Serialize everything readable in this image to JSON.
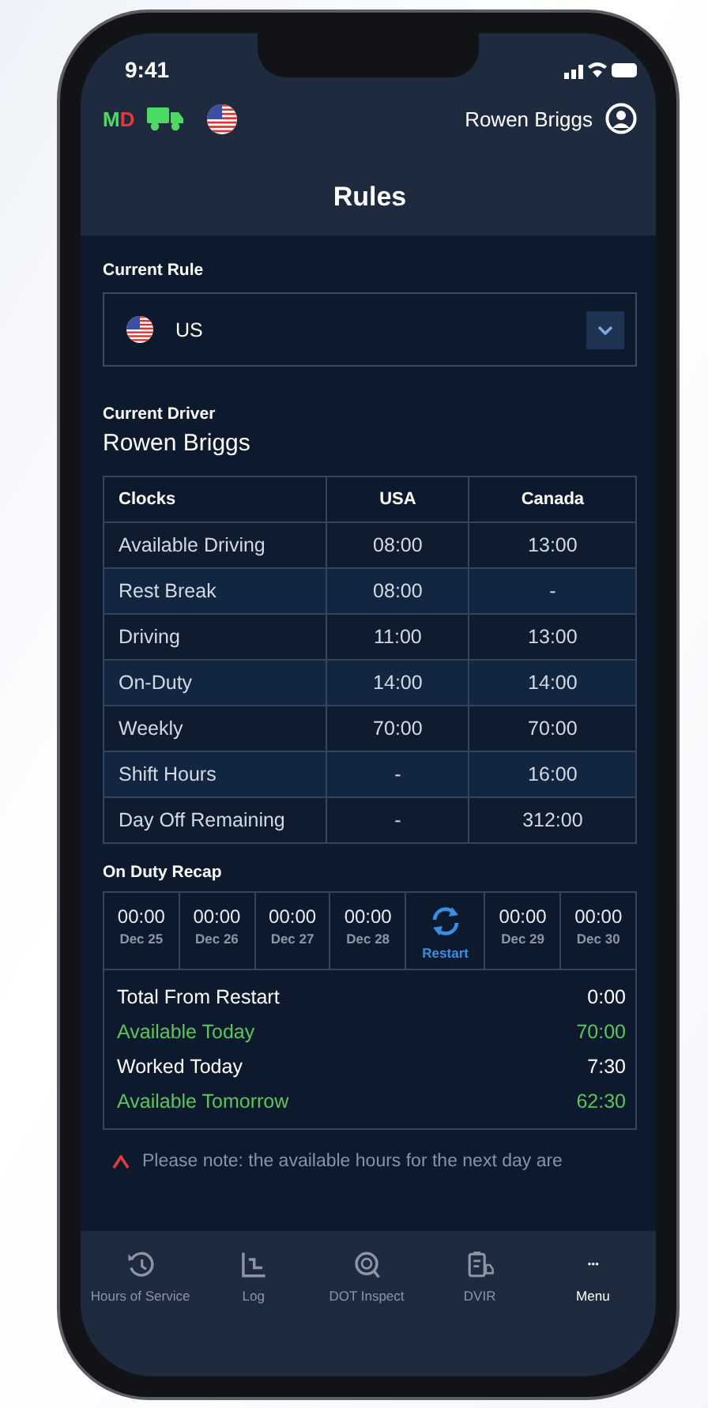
{
  "status_bar": {
    "time": "9:41"
  },
  "top_bar": {
    "badge_letters": [
      {
        "text": "M",
        "color": "#4cd964"
      },
      {
        "text": "D",
        "color": "#e5383b"
      }
    ],
    "user_name": "Rowen Briggs"
  },
  "title": "Rules",
  "current_rule": {
    "label": "Current Rule",
    "value": "US"
  },
  "current_driver": {
    "label": "Current Driver",
    "name": "Rowen Briggs"
  },
  "clocks_table": {
    "columns": [
      "Clocks",
      "USA",
      "Canada"
    ],
    "rows": [
      [
        "Available Driving",
        "08:00",
        "13:00"
      ],
      [
        "Rest Break",
        "08:00",
        "-"
      ],
      [
        "Driving",
        "11:00",
        "13:00"
      ],
      [
        "On-Duty",
        "14:00",
        "14:00"
      ],
      [
        "Weekly",
        "70:00",
        "70:00"
      ],
      [
        "Shift Hours",
        "-",
        "16:00"
      ],
      [
        "Day Off Remaining",
        "-",
        "312:00"
      ]
    ]
  },
  "on_duty_recap": {
    "title": "On Duty Recap",
    "days": [
      {
        "kind": "day",
        "time": "00:00",
        "date": "Dec 25"
      },
      {
        "kind": "day",
        "time": "00:00",
        "date": "Dec 26"
      },
      {
        "kind": "day",
        "time": "00:00",
        "date": "Dec 27"
      },
      {
        "kind": "day",
        "time": "00:00",
        "date": "Dec 28"
      },
      {
        "kind": "restart",
        "label": "Restart"
      },
      {
        "kind": "day",
        "time": "00:00",
        "date": "Dec 29"
      },
      {
        "kind": "day",
        "time": "00:00",
        "date": "Dec 30"
      }
    ],
    "totals": [
      {
        "label": "Total From Restart",
        "value": "0:00",
        "highlight": false
      },
      {
        "label": "Available Today",
        "value": "70:00",
        "highlight": true
      },
      {
        "label": "Worked Today",
        "value": "7:30",
        "highlight": false
      },
      {
        "label": "Available Tomorrow",
        "value": "62:30",
        "highlight": true
      }
    ]
  },
  "note": {
    "text": "Please note: the available hours for the next day are"
  },
  "nav": [
    {
      "label": "Hours of Service",
      "selected": false
    },
    {
      "label": "Log",
      "selected": false
    },
    {
      "label": "DOT Inspect",
      "selected": false
    },
    {
      "label": "DVIR",
      "selected": false
    },
    {
      "label": "Menu",
      "selected": true
    }
  ]
}
